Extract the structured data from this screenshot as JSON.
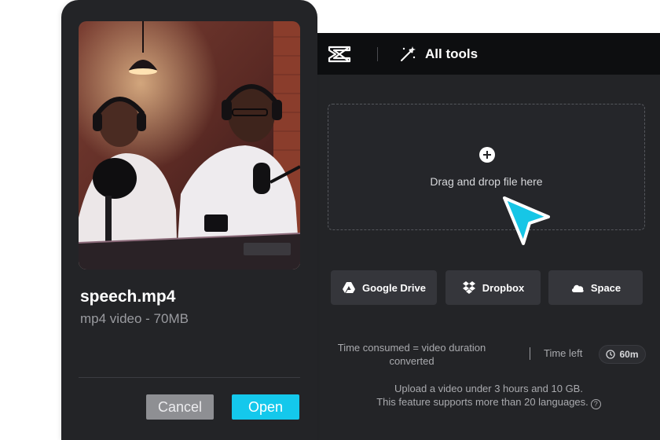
{
  "topbar": {
    "logo_icon": "capcut-logo-icon",
    "tools_icon": "magic-wand-icon",
    "tools_label": "All tools"
  },
  "dropzone": {
    "icon": "plus-circle-icon",
    "text": "Drag and drop file here"
  },
  "sources": [
    {
      "label": "Google Drive",
      "icon": "google-drive-icon"
    },
    {
      "label": "Dropbox",
      "icon": "dropbox-icon"
    },
    {
      "label": "Space",
      "icon": "cloud-icon"
    }
  ],
  "usage": {
    "consumed": "Time consumed = video duration converted",
    "time_left_label": "Time left",
    "time_left_value": "60m"
  },
  "notes": {
    "line1": "Upload a video under 3 hours and 10 GB.",
    "line2": "This feature supports more than 20 languages."
  },
  "file": {
    "name": "speech.mp4",
    "meta": "mp4 video - 70MB",
    "cancel_label": "Cancel",
    "open_label": "Open"
  },
  "colors": {
    "accent": "#14c8ec",
    "panel": "#232427",
    "topbar": "#0d0e10"
  }
}
